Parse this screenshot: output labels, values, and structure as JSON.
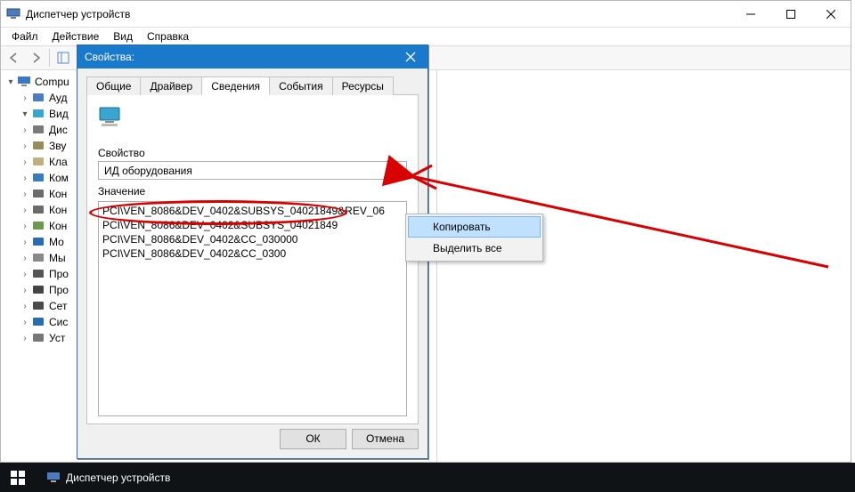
{
  "main_window": {
    "title": "Диспетчер устройств",
    "menu": {
      "file": "Файл",
      "action": "Действие",
      "view": "Вид",
      "help": "Справка"
    },
    "tree": {
      "computer": "Compu",
      "items": [
        {
          "label": "Ауд"
        },
        {
          "label": "Вид"
        },
        {
          "label": "Дис"
        },
        {
          "label": "Зву"
        },
        {
          "label": "Кла"
        },
        {
          "label": "Ком"
        },
        {
          "label": "Кон"
        },
        {
          "label": "Кон"
        },
        {
          "label": "Кон"
        },
        {
          "label": "Мо"
        },
        {
          "label": "Мы"
        },
        {
          "label": "Про"
        },
        {
          "label": "Про"
        },
        {
          "label": "Сет"
        },
        {
          "label": "Сис"
        },
        {
          "label": "Уст"
        }
      ]
    }
  },
  "dialog": {
    "title": "Свойства:",
    "tabs": {
      "general": "Общие",
      "driver": "Драйвер",
      "details": "Сведения",
      "events": "События",
      "resources": "Ресурсы"
    },
    "property_label": "Свойство",
    "property_value": "ИД оборудования",
    "value_label": "Значение",
    "values": [
      "PCI\\VEN_8086&DEV_0402&SUBSYS_04021849&REV_06",
      "PCI\\VEN_8086&DEV_0402&SUBSYS_04021849",
      "PCI\\VEN_8086&DEV_0402&CC_030000",
      "PCI\\VEN_8086&DEV_0402&CC_0300"
    ],
    "ok": "ОК",
    "cancel": "Отмена"
  },
  "context_menu": {
    "copy": "Копировать",
    "select_all": "Выделить все"
  },
  "taskbar": {
    "item": "Диспетчер устройств"
  },
  "tree_icon_colors": [
    "#4a7dc4",
    "#3aa6d0",
    "#7a7a7a",
    "#9a8a5a",
    "#c0b080",
    "#3a7abf",
    "#6b6b6b",
    "#6b6b6b",
    "#6b9a4a",
    "#2a6cb3",
    "#888888",
    "#555555",
    "#454545",
    "#4a4a4a",
    "#2a6cb3",
    "#777777"
  ]
}
